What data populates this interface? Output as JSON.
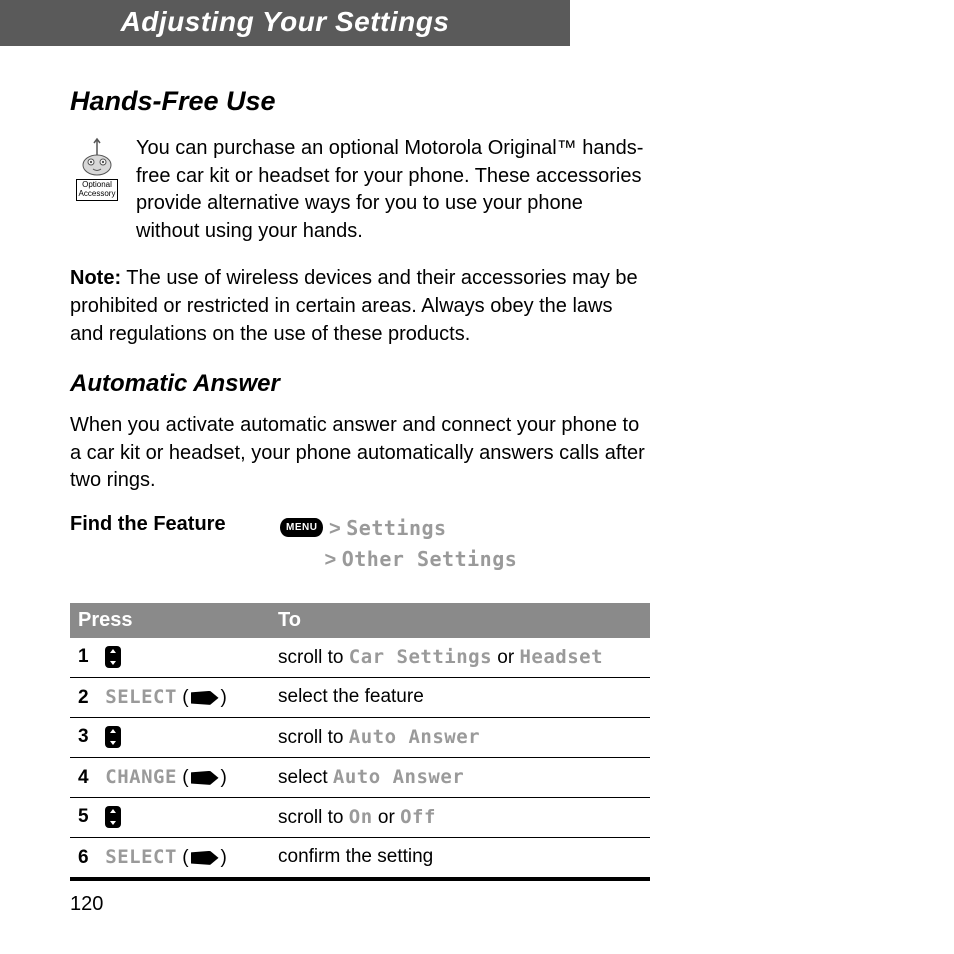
{
  "chapter_title": "Adjusting Your Settings",
  "page_number": "120",
  "hands_free": {
    "heading": "Hands-Free Use",
    "accessory_label_line1": "Optional",
    "accessory_label_line2": "Accessory",
    "intro": "You can purchase an optional Motorola Original™ hands-free car kit or headset for your phone. These accessories provide alternative ways for you to use your phone without using your hands.",
    "note_label": "Note:",
    "note_body": " The use of wireless devices and their accessories may be prohibited or restricted in certain areas. Always obey the laws and regulations on the use of these products."
  },
  "auto_answer": {
    "heading": "Automatic Answer",
    "intro": "When you activate automatic answer and connect your phone to a car kit or headset, your phone automatically answers calls after two rings.",
    "find_feature_label": "Find the Feature",
    "menu_key_label": "MENU",
    "path1": "Settings",
    "path2": "Other Settings",
    "table": {
      "col_press": "Press",
      "col_to": "To",
      "rows": [
        {
          "n": "1",
          "press_label": "",
          "press_ui": "",
          "key": "scroll",
          "to_pre": "scroll to ",
          "to_ui1": "Car Settings",
          "to_mid": " or ",
          "to_ui2": "Headset",
          "to_post": ""
        },
        {
          "n": "2",
          "press_label": "",
          "press_ui": "SELECT",
          "key": "soft",
          "to_pre": "select the feature",
          "to_ui1": "",
          "to_mid": "",
          "to_ui2": "",
          "to_post": ""
        },
        {
          "n": "3",
          "press_label": "",
          "press_ui": "",
          "key": "scroll",
          "to_pre": "scroll to ",
          "to_ui1": "Auto Answer",
          "to_mid": "",
          "to_ui2": "",
          "to_post": ""
        },
        {
          "n": "4",
          "press_label": "",
          "press_ui": "CHANGE",
          "key": "soft",
          "to_pre": "select ",
          "to_ui1": "Auto Answer",
          "to_mid": "",
          "to_ui2": "",
          "to_post": ""
        },
        {
          "n": "5",
          "press_label": "",
          "press_ui": "",
          "key": "scroll",
          "to_pre": "scroll to ",
          "to_ui1": "On",
          "to_mid": " or ",
          "to_ui2": "Off",
          "to_post": ""
        },
        {
          "n": "6",
          "press_label": "",
          "press_ui": "SELECT",
          "key": "soft",
          "to_pre": "confirm the setting",
          "to_ui1": "",
          "to_mid": "",
          "to_ui2": "",
          "to_post": ""
        }
      ]
    }
  }
}
